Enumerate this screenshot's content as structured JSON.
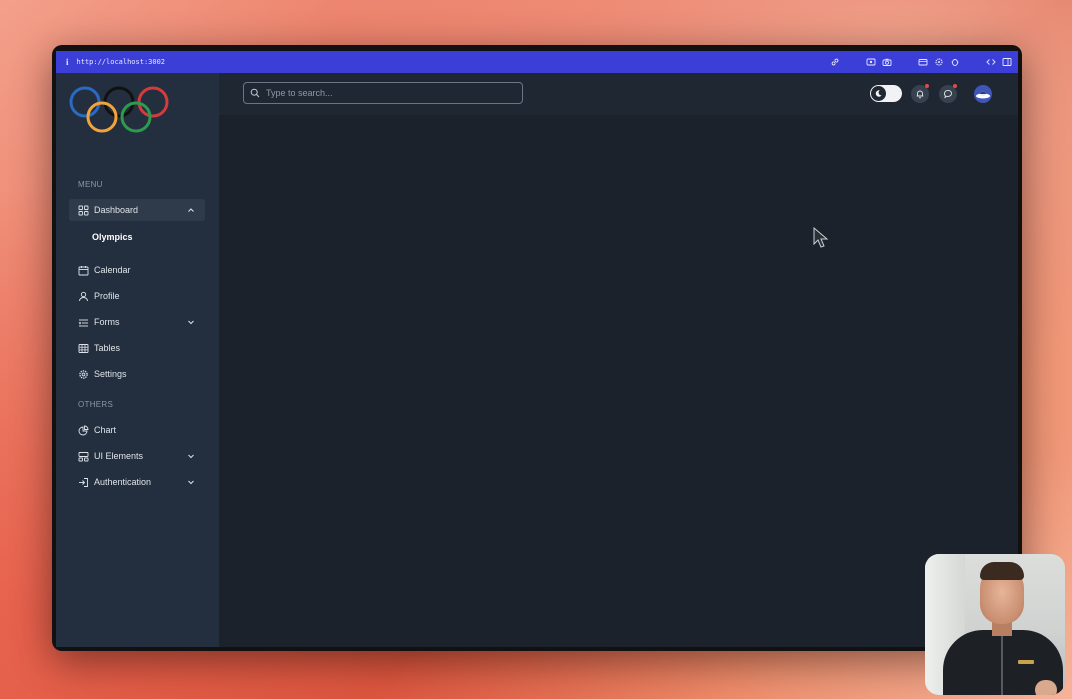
{
  "browser": {
    "info_glyph": "i",
    "url": "http://localhost:3002"
  },
  "sidebar": {
    "menu_heading": "MENU",
    "others_heading": "OTHERS",
    "items": [
      {
        "label": "Dashboard",
        "icon": "grid-icon",
        "expanded": true
      },
      {
        "label": "Calendar",
        "icon": "calendar-icon"
      },
      {
        "label": "Profile",
        "icon": "user-icon"
      },
      {
        "label": "Forms",
        "icon": "forms-icon",
        "expandable": true
      },
      {
        "label": "Tables",
        "icon": "table-icon"
      },
      {
        "label": "Settings",
        "icon": "gear-icon"
      }
    ],
    "sub_items": [
      {
        "label": "Olympics"
      }
    ],
    "others": [
      {
        "label": "Chart",
        "icon": "pie-chart-icon"
      },
      {
        "label": "UI Elements",
        "icon": "layout-icon",
        "expandable": true
      },
      {
        "label": "Authentication",
        "icon": "login-icon",
        "expandable": true
      }
    ]
  },
  "header": {
    "search_placeholder": "Type to search...",
    "dark_mode": true,
    "notification_dot": true,
    "message_dot": true
  },
  "colors": {
    "url_bar": "#3b3fd8",
    "sidebar_bg": "#232f3e",
    "main_bg": "#1b222c",
    "ring_blue": "#2a6ac2",
    "ring_black": "#111111",
    "ring_red": "#d63b3b",
    "ring_yellow": "#f2a43a",
    "ring_green": "#2d9a4f"
  }
}
